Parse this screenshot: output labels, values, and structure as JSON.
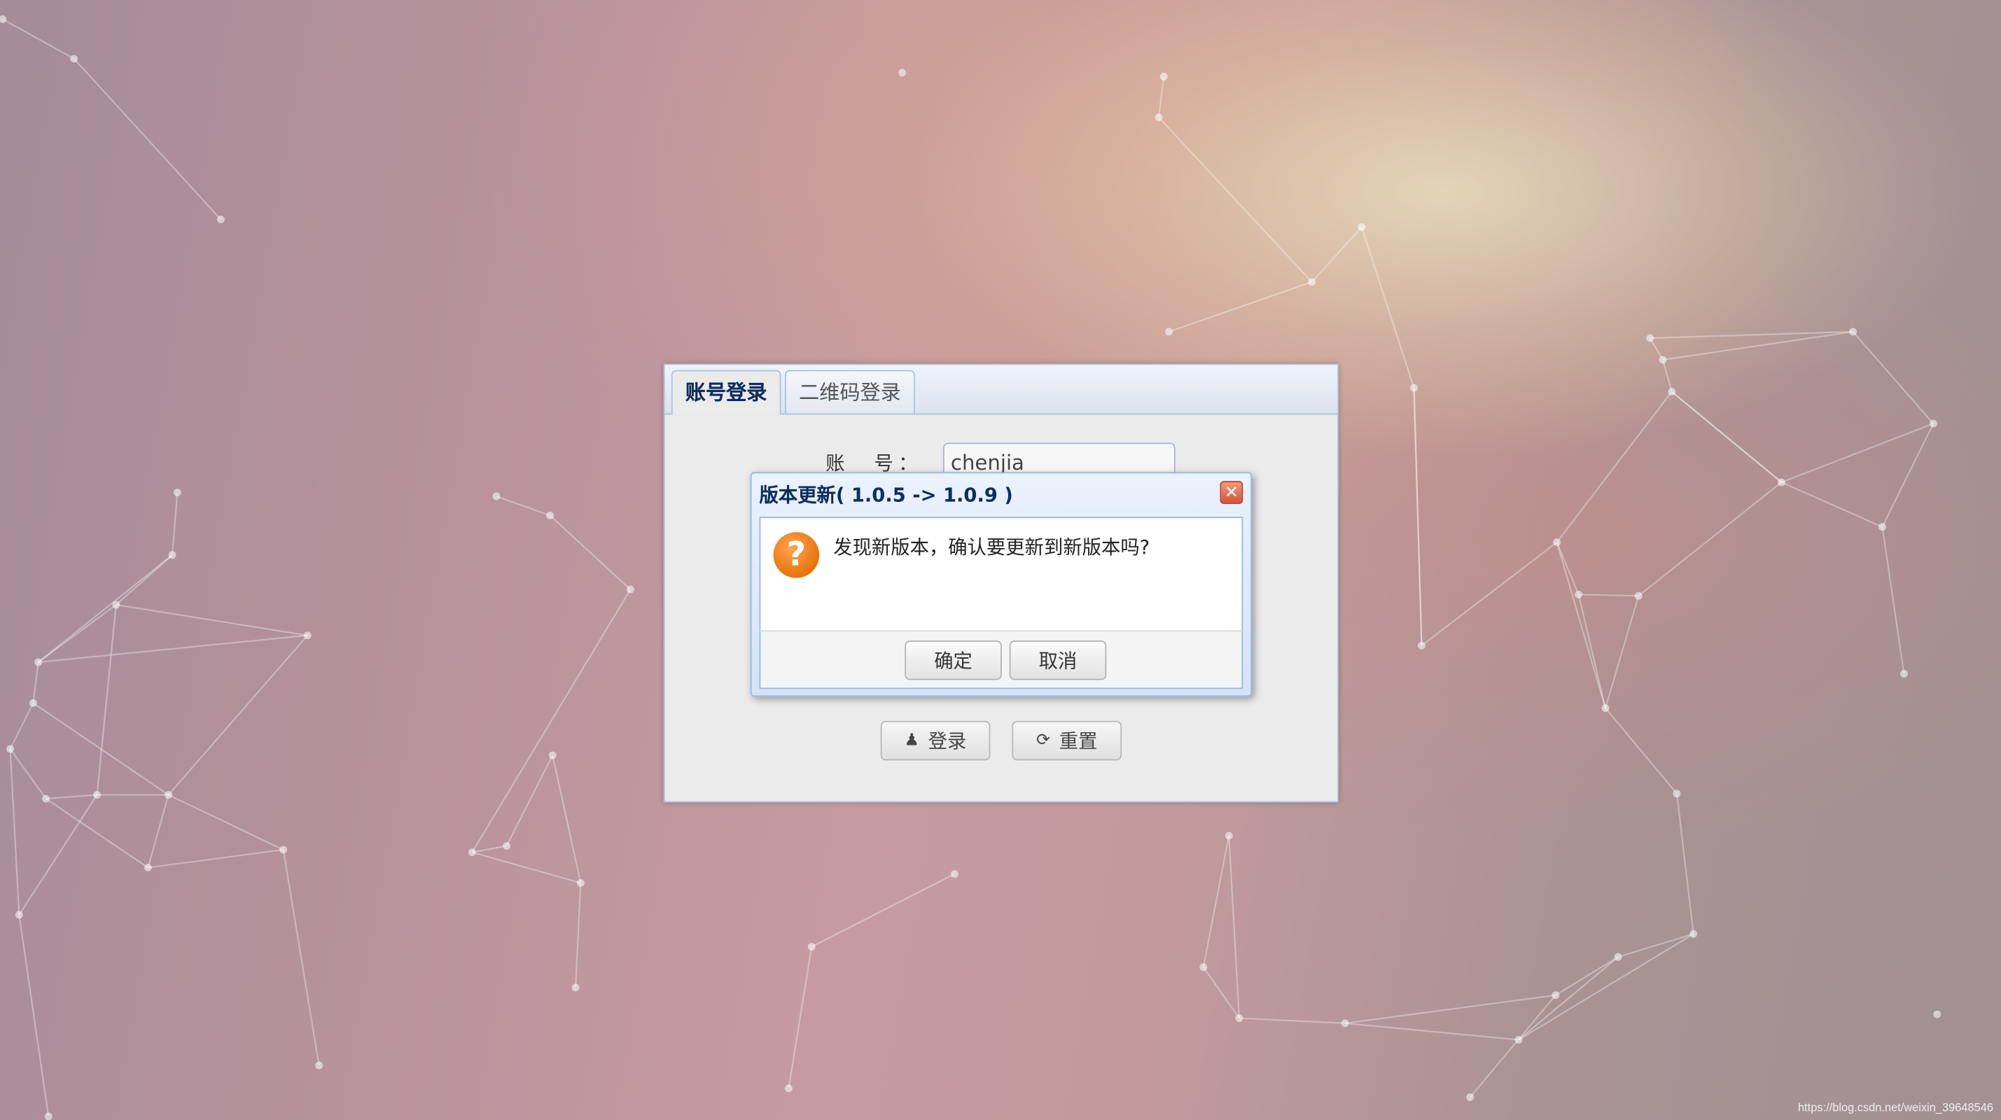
{
  "login_panel": {
    "tabs": [
      {
        "label": "账号登录",
        "active": true
      },
      {
        "label": "二维码登录",
        "active": false
      }
    ],
    "account_label": "账　号：",
    "account_value": "chenjia",
    "login_button": "登录",
    "reset_button": "重置",
    "login_icon": "user-icon",
    "reset_icon": "refresh-icon"
  },
  "dialog": {
    "title": "版本更新( 1.0.5 -> 1.0.9 )",
    "close_glyph": "✕",
    "icon": "question-icon",
    "icon_glyph": "?",
    "message": "发现新版本，确认要更新到新版本吗?",
    "ok_label": "确定",
    "cancel_label": "取消"
  },
  "watermark": "https://blog.csdn.net/weixin_39648546",
  "colors": {
    "dialog_title": "#0e2d5f",
    "dialog_border": "#95b8e7",
    "question_icon": "#e8730c",
    "close_button": "#d4543a"
  }
}
